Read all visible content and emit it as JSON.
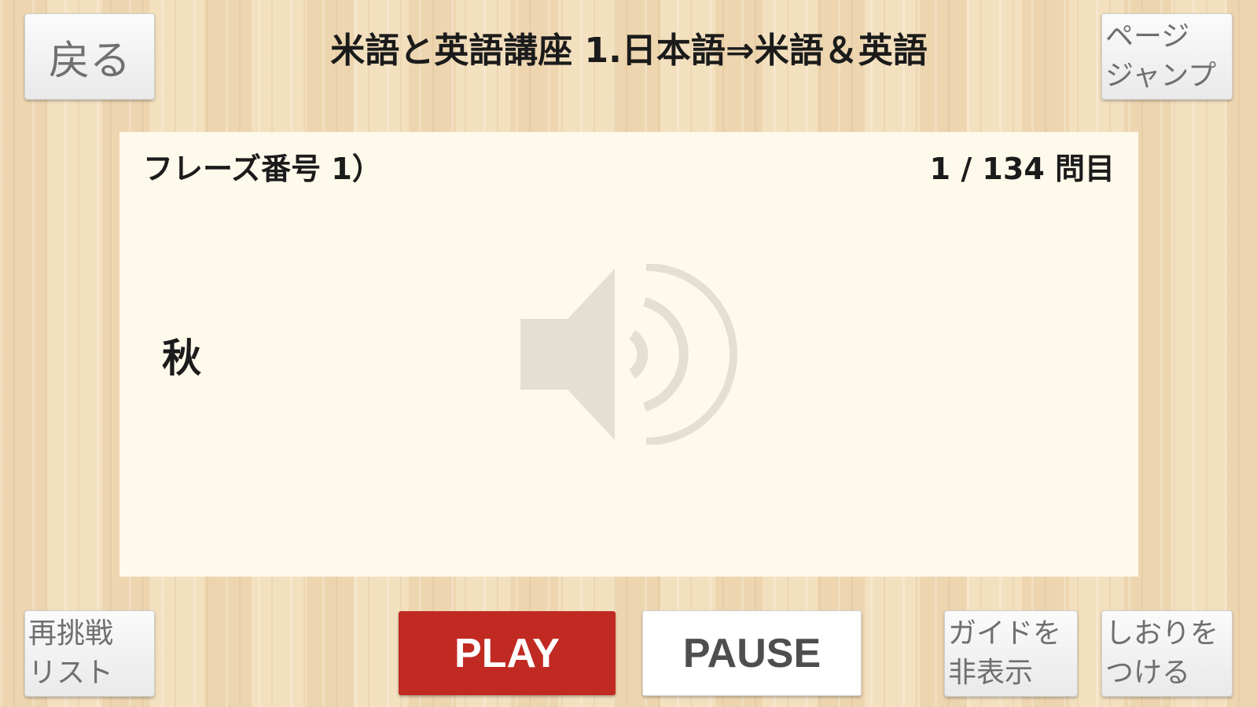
{
  "header": {
    "title": "米語と英語講座 1.日本語⇒米語＆英語",
    "back_label": "戻る",
    "page_jump_label": [
      "ページ",
      "ジャンプ"
    ]
  },
  "card": {
    "phrase_label": "フレーズ番号 1）",
    "counter": "1 / 134 問目",
    "phrase_text": "秋",
    "speaker_icon": "speaker-volume-icon"
  },
  "footer": {
    "retry_list_label": [
      "再挑戦",
      "リスト"
    ],
    "play_label": "PLAY",
    "pause_label": "PAUSE",
    "guide_toggle_label": [
      "ガイドを",
      "非表示"
    ],
    "bookmark_label": [
      "しおりを",
      "つける"
    ]
  },
  "colors": {
    "background_wood": "#f1dcb9",
    "card_background": "#fefaeb",
    "play_button": "#c02a22",
    "button_text_gray": "#6f6f6f",
    "speaker_icon": "#e3dfd2"
  }
}
